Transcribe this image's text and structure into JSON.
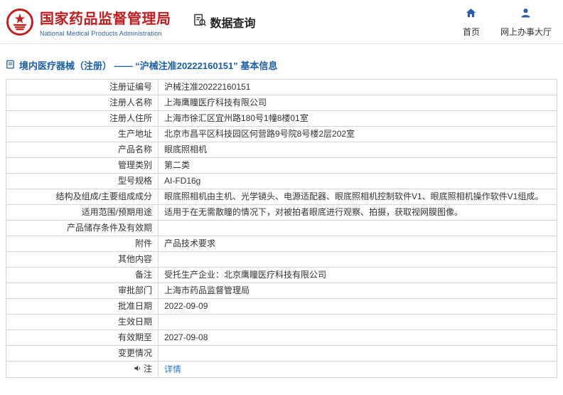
{
  "header": {
    "org_name_cn": "国家药品监督管理局",
    "org_name_en": "National Medical Products Administration",
    "section_title": "数据查询",
    "nav": {
      "home": "首页",
      "service_hall": "网上办事大厅"
    }
  },
  "breadcrumb": {
    "text": "境内医疗器械（注册） —— “沪械注准20222160151” 基本信息"
  },
  "table": {
    "rows": [
      {
        "label": "注册证编号",
        "value": "沪械注准20222160151"
      },
      {
        "label": "注册人名称",
        "value": "上海鹰瞳医疗科技有限公司"
      },
      {
        "label": "注册人住所",
        "value": "上海市徐汇区宜州路180号1幢8楼01室"
      },
      {
        "label": "生产地址",
        "value": "北京市昌平区科技园区何营路9号院8号楼2层202室"
      },
      {
        "label": "产品名称",
        "value": "眼底照相机"
      },
      {
        "label": "管理类别",
        "value": "第二类"
      },
      {
        "label": "型号规格",
        "value": "AI-FD16g"
      },
      {
        "label": "结构及组成/主要组成成分",
        "value": "眼底照相机由主机、光学镜头、电源适配器、眼底照相机控制软件V1、眼底照相机操作软件V1组成。"
      },
      {
        "label": "适用范围/预期用途",
        "value": "适用于在无需散瞳的情况下，对被拍者眼底进行观察、拍摄，获取视网膜图像。"
      },
      {
        "label": "产品储存条件及有效期",
        "value": ""
      },
      {
        "label": "附件",
        "value": "产品技术要求"
      },
      {
        "label": "其他内容",
        "value": ""
      },
      {
        "label": "备注",
        "value": "受托生产企业：北京鹰瞳医疗科技有限公司"
      },
      {
        "label": "审批部门",
        "value": "上海市药品监督管理局"
      },
      {
        "label": "批准日期",
        "value": "2022-09-09"
      },
      {
        "label": "生效日期",
        "value": ""
      },
      {
        "label": "有效期至",
        "value": "2027-09-08"
      },
      {
        "label": "变更情况",
        "value": ""
      },
      {
        "label": "注",
        "value": "详情"
      }
    ]
  },
  "colors": {
    "brand_red": "#c21d1d",
    "brand_blue": "#2a5caa",
    "breadcrumb_blue": "#1c5fa8",
    "link_blue": "#2b7bd4"
  }
}
